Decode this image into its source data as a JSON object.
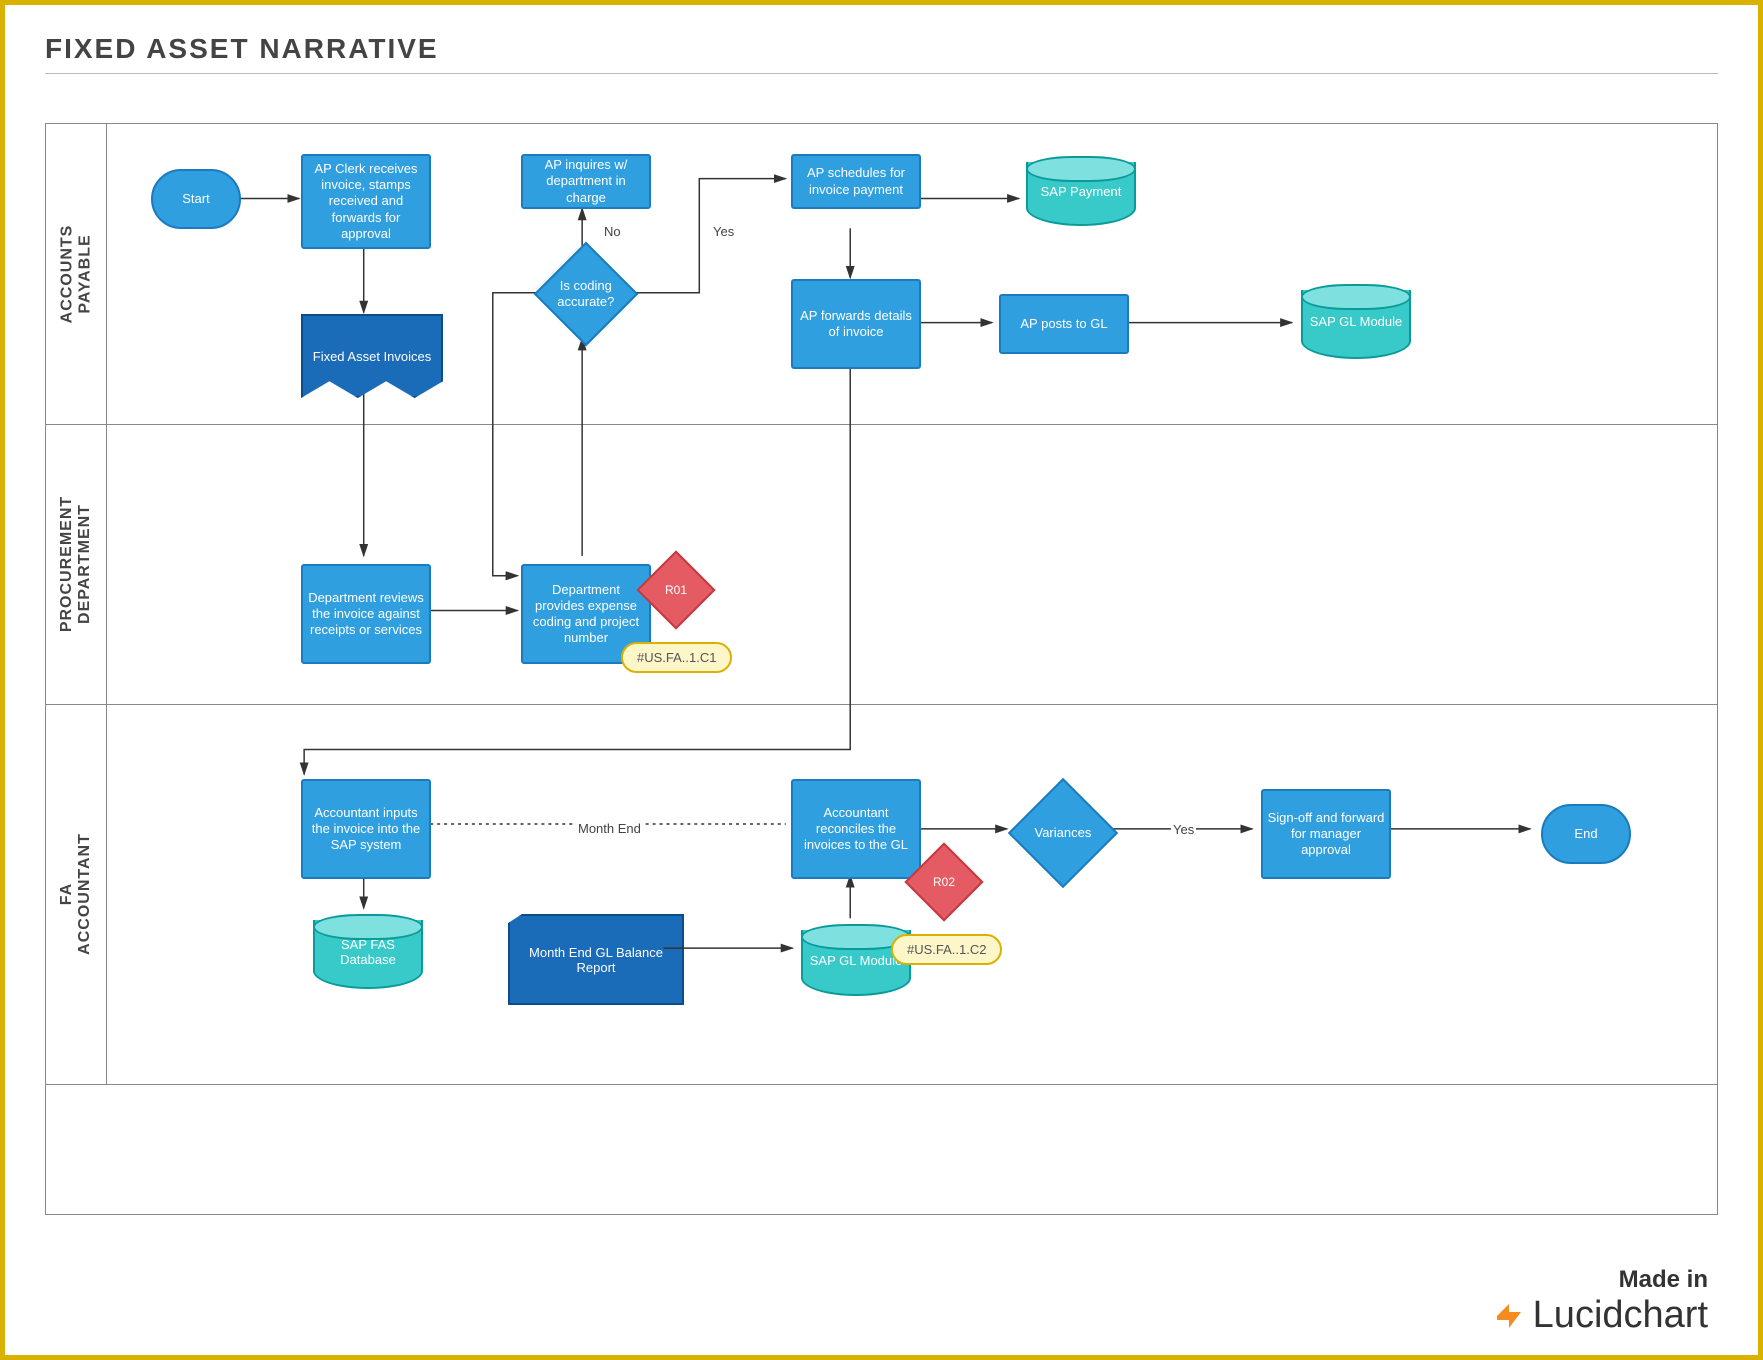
{
  "title": "FIXED ASSET NARRATIVE",
  "footer": {
    "made": "Made in",
    "brand": "Lucidchart"
  },
  "lanes": {
    "l1": "ACCOUNTS\nPAYABLE",
    "l2": "PROCUREMENT\nDEPARTMENT",
    "l3": "FA\nACCOUNTANT"
  },
  "nodes": {
    "start": "Start",
    "end": "End",
    "ap_receive": "AP Clerk receives invoice, stamps received and forwards for approval",
    "fa_invoices": "Fixed Asset Invoices",
    "ap_inquire": "AP inquires w/ department in charge",
    "coding_q": "Is coding accurate?",
    "ap_schedule": "AP schedules for invoice payment",
    "sap_payment": "SAP Payment",
    "ap_forward": "AP forwards details of invoice",
    "ap_post_gl": "AP posts to GL",
    "sap_gl_mod1": "SAP GL Module",
    "dept_review": "Department reviews the invoice against receipts or services",
    "dept_coding": "Department provides expense coding and project number",
    "r01": "R01",
    "tag1": "#US.FA..1.C1",
    "acct_input": "Accountant inputs the invoice into the SAP system",
    "sap_fas": "SAP FAS Database",
    "month_end_label": "Month End",
    "me_report": "Month End GL Balance Report",
    "sap_gl_mod2": "SAP GL Module",
    "acct_recon": "Accountant reconciles the invoices to the GL",
    "r02": "R02",
    "tag2": "#US.FA..1.C2",
    "variances": "Variances",
    "signoff": "Sign-off and forward for manager approval",
    "no": "No",
    "yes": "Yes",
    "yes2": "Yes"
  }
}
